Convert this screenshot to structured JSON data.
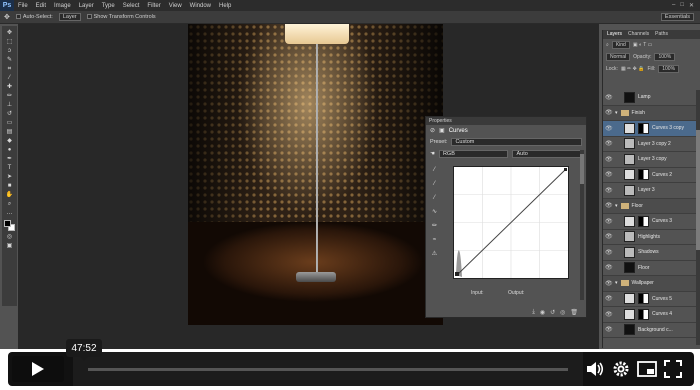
{
  "menu": {
    "logo": "Ps",
    "items": [
      "File",
      "Edit",
      "Image",
      "Layer",
      "Type",
      "Select",
      "Filter",
      "View",
      "Window",
      "Help"
    ],
    "window_controls": [
      "–",
      "□",
      "✕"
    ]
  },
  "options": {
    "auto_select": "Auto-Select:",
    "auto_select_value": "Layer",
    "show_transform": "Show Transform Controls",
    "workspace": "Essentials"
  },
  "properties": {
    "panel_title": "Properties",
    "adjustment": "Curves",
    "preset_label": "Preset:",
    "preset_value": "Custom",
    "channel_value": "RGB",
    "auto_label": "Auto",
    "input_label": "Input:",
    "output_label": "Output:"
  },
  "layers": {
    "tabs": [
      "Layers",
      "Channels",
      "Paths"
    ],
    "kind_label": "Kind",
    "blend_mode": "Normal",
    "opacity_label": "Opacity:",
    "opacity_value": "100%",
    "lock_label": "Lock:",
    "fill_label": "Fill:",
    "fill_value": "100%",
    "rows": [
      {
        "name": "Lamp",
        "kind": "layer",
        "thumb": "dark",
        "selected": false
      },
      {
        "name": "Finish",
        "kind": "group",
        "thumb": "",
        "selected": false
      },
      {
        "name": "Curves 3 copy",
        "kind": "adjust",
        "thumb": "mask",
        "selected": true
      },
      {
        "name": "Layer 3 copy 2",
        "kind": "layer",
        "thumb": "light",
        "selected": false
      },
      {
        "name": "Layer 3 copy",
        "kind": "layer",
        "thumb": "light",
        "selected": false
      },
      {
        "name": "Curves 2",
        "kind": "adjust",
        "thumb": "mask",
        "selected": false
      },
      {
        "name": "Layer 3",
        "kind": "layer",
        "thumb": "light",
        "selected": false
      },
      {
        "name": "Floor",
        "kind": "group",
        "thumb": "",
        "selected": false
      },
      {
        "name": "Curves 3",
        "kind": "adjust",
        "thumb": "mask",
        "selected": false
      },
      {
        "name": "Highlights",
        "kind": "layer",
        "thumb": "light",
        "selected": false
      },
      {
        "name": "Shadows",
        "kind": "layer",
        "thumb": "light",
        "selected": false
      },
      {
        "name": "Floor",
        "kind": "layer",
        "thumb": "dark",
        "selected": false
      },
      {
        "name": "Wallpaper",
        "kind": "group",
        "thumb": "",
        "selected": false
      },
      {
        "name": "Curves 5",
        "kind": "adjust",
        "thumb": "mask",
        "selected": false
      },
      {
        "name": "Curves 4",
        "kind": "adjust",
        "thumb": "mask",
        "selected": false
      },
      {
        "name": "Background c...",
        "kind": "layer",
        "thumb": "dark",
        "selected": false
      }
    ]
  },
  "player": {
    "tooltip_time": "47:52",
    "progress_fraction": 0.0,
    "icons": [
      "play-icon",
      "volume-icon",
      "settings-icon",
      "pip-icon",
      "fullscreen-icon"
    ]
  },
  "colors": {
    "ui_bg": "#535353",
    "selection": "#4b6a8c",
    "player_bar": "#111111"
  }
}
